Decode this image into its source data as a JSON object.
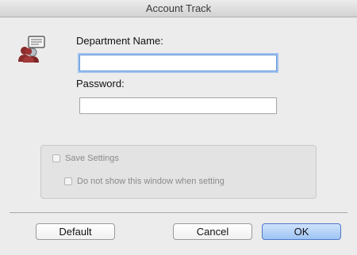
{
  "window": {
    "title": "Account Track"
  },
  "icons": {
    "account_icon": "account-track-users-icon"
  },
  "form": {
    "department_label": "Department Name:",
    "department_value": "",
    "password_label": "Password:",
    "password_value": ""
  },
  "options": {
    "save_settings_label": "Save Settings",
    "save_settings_checked": false,
    "do_not_show_label": "Do not show this window when setting",
    "do_not_show_checked": false
  },
  "buttons": {
    "default_label": "Default",
    "cancel_label": "Cancel",
    "ok_label": "OK"
  },
  "colors": {
    "primary_button": "#9ec4f4",
    "focus_ring": "#9ec1f0"
  }
}
